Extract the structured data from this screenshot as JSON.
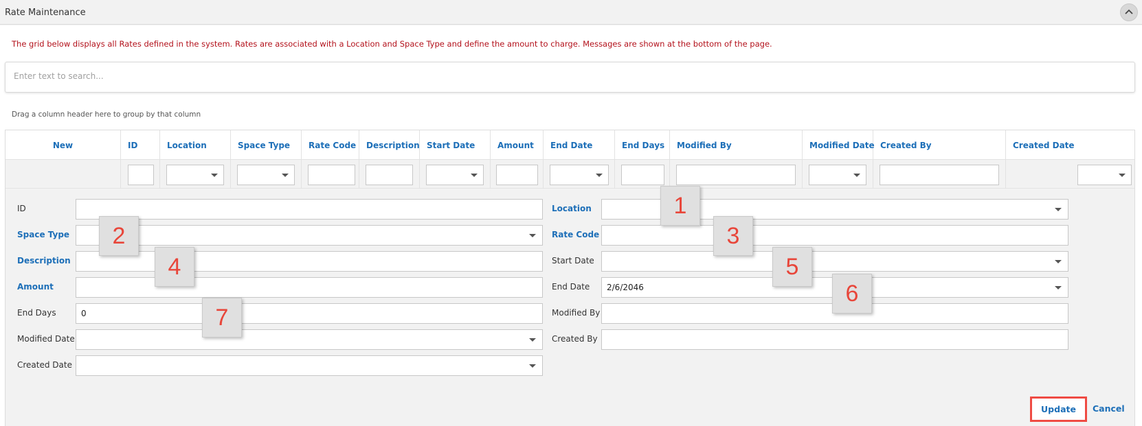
{
  "panel": {
    "title": "Rate Maintenance"
  },
  "intro_text": "The grid below displays all Rates defined in the system. Rates are associated with a Location and Space Type and define the amount to charge. Messages are shown at the bottom of the page.",
  "search": {
    "placeholder": "Enter text to search..."
  },
  "group_hint": "Drag a column header here to group by that column",
  "grid": {
    "columns": [
      {
        "label": "New",
        "filter": "none"
      },
      {
        "label": "ID",
        "filter": "text"
      },
      {
        "label": "Location",
        "filter": "dropdown"
      },
      {
        "label": "Space Type",
        "filter": "dropdown"
      },
      {
        "label": "Rate Code",
        "filter": "text"
      },
      {
        "label": "Description",
        "filter": "text"
      },
      {
        "label": "Start Date",
        "filter": "dropdown"
      },
      {
        "label": "Amount",
        "filter": "text"
      },
      {
        "label": "End Date",
        "filter": "dropdown"
      },
      {
        "label": "End Days",
        "filter": "text"
      },
      {
        "label": "Modified By",
        "filter": "text"
      },
      {
        "label": "Modified Date",
        "filter": "dropdown"
      },
      {
        "label": "Created By",
        "filter": "text"
      },
      {
        "label": "Created Date",
        "filter": "dropdown"
      }
    ]
  },
  "form": {
    "left": [
      {
        "label": "ID",
        "required": false,
        "value": "",
        "type": "text"
      },
      {
        "label": "Space Type",
        "required": true,
        "value": "",
        "type": "dropdown"
      },
      {
        "label": "Description",
        "required": true,
        "value": "",
        "type": "text"
      },
      {
        "label": "Amount",
        "required": true,
        "value": "",
        "type": "text"
      },
      {
        "label": "End Days",
        "required": false,
        "value": "0",
        "type": "text"
      },
      {
        "label": "Modified Date",
        "required": false,
        "value": "",
        "type": "dropdown"
      },
      {
        "label": "Created Date",
        "required": false,
        "value": "",
        "type": "dropdown"
      }
    ],
    "right": [
      {
        "label": "Location",
        "required": true,
        "value": "",
        "type": "dropdown"
      },
      {
        "label": "Rate Code",
        "required": true,
        "value": "",
        "type": "text"
      },
      {
        "label": "Start Date",
        "required": false,
        "value": "",
        "type": "dropdown"
      },
      {
        "label": "End Date",
        "required": false,
        "value": "2/6/2046",
        "type": "dropdown"
      },
      {
        "label": "Modified By",
        "required": false,
        "value": "",
        "type": "text"
      },
      {
        "label": "Created By",
        "required": false,
        "value": "",
        "type": "text"
      }
    ]
  },
  "markers": [
    "1",
    "2",
    "3",
    "4",
    "5",
    "6",
    "7"
  ],
  "buttons": {
    "update": "Update",
    "cancel": "Cancel"
  },
  "colors": {
    "accent": "#1d6fb8",
    "intro": "#b3111b",
    "highlight": "#ef4b43",
    "marker_digit": "#e8463a"
  }
}
